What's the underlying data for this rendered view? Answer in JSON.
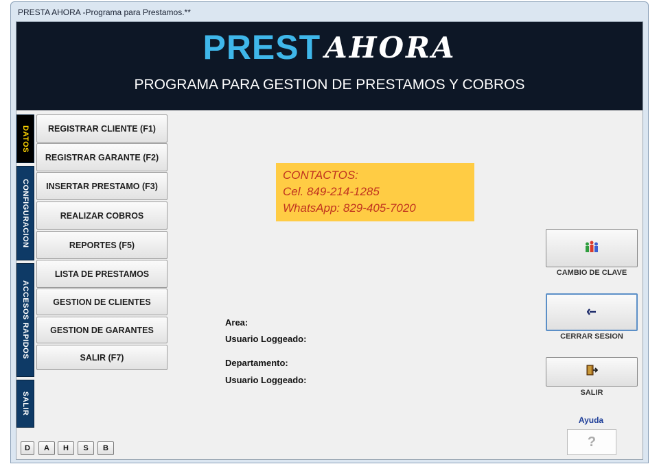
{
  "window": {
    "title": "PRESTA AHORA -Programa para Prestamos.**"
  },
  "banner": {
    "brand_part1": "PREST",
    "brand_part2": "AHORA",
    "subtitle": "PROGRAMA PARA GESTION DE PRESTAMOS Y COBROS"
  },
  "vertical_tabs": [
    "DATOS",
    "CONFIGURACION",
    "ACCESOS RAPIDOS",
    "SALIR"
  ],
  "menu": [
    "REGISTRAR CLIENTE (F1)",
    "REGISTRAR GARANTE (F2)",
    "INSERTAR PRESTAMO (F3)",
    "REALIZAR COBROS",
    "REPORTES (F5)",
    "LISTA DE PRESTAMOS",
    "GESTION DE CLIENTES",
    "GESTION DE GARANTES",
    "SALIR (F7)"
  ],
  "contacts": [
    "CONTACTOS:",
    "Cel. 849-214-1285",
    "WhatsApp: 829-405-7020"
  ],
  "info": {
    "area": "Area:",
    "user1": "Usuario Loggeado:",
    "department": "Departamento:",
    "user2": "Usuario Loggeado:"
  },
  "side_buttons": {
    "password": "CAMBIO DE CLAVE",
    "logout": "CERRAR SESION",
    "exit": "SALIR"
  },
  "help": {
    "label": "Ayuda",
    "symbol": "?"
  },
  "shortcut_buttons": [
    "D",
    "A",
    "H",
    "S",
    "B"
  ],
  "icons": {
    "password": "users-icon",
    "logout": "arrow-left-icon",
    "exit": "exit-door-icon"
  },
  "colors": {
    "banner_bg": "#0d1726",
    "brand_blue": "#3fb7ea",
    "tab_blue": "#0e3a66",
    "active_tab_text": "#ffd400",
    "contacts_bg": "#ffcc44",
    "contacts_text": "#c0321f"
  }
}
